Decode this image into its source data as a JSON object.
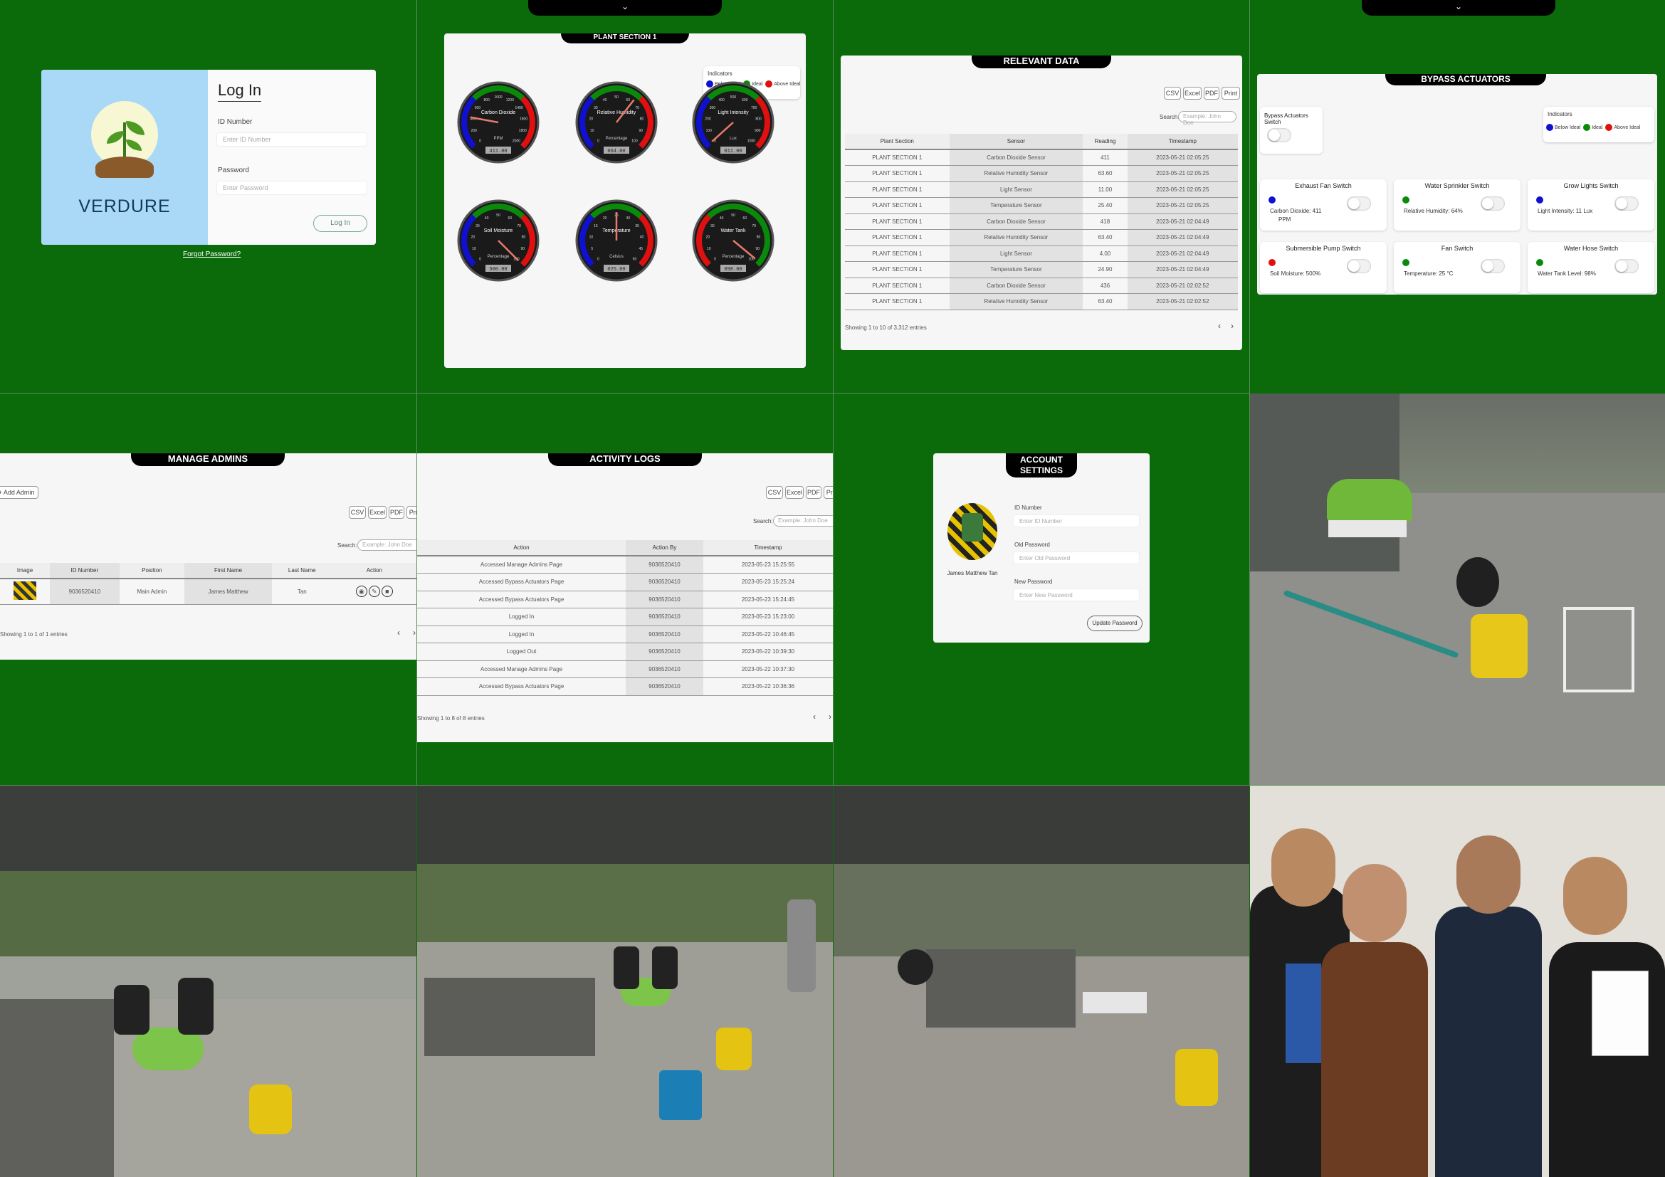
{
  "login": {
    "brand": "VERDURE",
    "heading": "Log In",
    "id_label": "ID Number",
    "id_placeholder": "Enter ID Number",
    "password_label": "Password",
    "password_placeholder": "Enter Password",
    "login_button": "Log In",
    "forgot_link": "Forgot Password?"
  },
  "plant_section": {
    "toggle_glyph": "⌄",
    "title": "PLANT SECTION 1",
    "indicators_title": "Indicators",
    "legend": [
      {
        "label": "Below Ideal",
        "color": "#1010d0"
      },
      {
        "label": "Ideal",
        "color": "#0a8a0a"
      },
      {
        "label": "Above Ideal",
        "color": "#e01010"
      }
    ],
    "gauges": [
      {
        "name": "Carbon Dioxide",
        "unit": "PPM",
        "value": "411.00",
        "reading": 411,
        "max": 2000,
        "ticks": [
          "0",
          "200",
          "400",
          "600",
          "800",
          "1000",
          "1200",
          "1400",
          "1600",
          "1800",
          "2000"
        ]
      },
      {
        "name": "Relative Humidity",
        "unit": "Percentage",
        "value": "064.00",
        "reading": 64,
        "max": 100,
        "ticks": [
          "0",
          "10",
          "20",
          "30",
          "40",
          "50",
          "60",
          "70",
          "80",
          "90",
          "100"
        ]
      },
      {
        "name": "Light Intensity",
        "unit": "Lux",
        "value": "011.00",
        "reading": 11,
        "max": 1000,
        "ticks": [
          "0",
          "100",
          "200",
          "300",
          "400",
          "500",
          "600",
          "700",
          "800",
          "900",
          "1000"
        ]
      },
      {
        "name": "Soil Moisture",
        "unit": "Percentage",
        "value": "500.00",
        "reading": 100,
        "max": 100,
        "ticks": [
          "0",
          "10",
          "20",
          "30",
          "40",
          "50",
          "60",
          "70",
          "80",
          "90",
          "100"
        ]
      },
      {
        "name": "Temperature",
        "unit": "Celsius",
        "value": "025.00",
        "reading": 25,
        "max": 50,
        "ticks": [
          "0",
          "5",
          "10",
          "15",
          "20",
          "25",
          "30",
          "35",
          "40",
          "45",
          "50"
        ]
      },
      {
        "name": "Water Tank",
        "unit": "Percentage",
        "value": "098.00",
        "reading": 98,
        "max": 100,
        "ticks": [
          "0",
          "10",
          "20",
          "30",
          "40",
          "50",
          "60",
          "70",
          "80",
          "90",
          "100"
        ]
      }
    ]
  },
  "relevant_data": {
    "title": "RELEVANT DATA",
    "export_buttons": [
      "CSV",
      "Excel",
      "PDF",
      "Print"
    ],
    "search_label": "Search:",
    "search_placeholder": "Example: John Doe",
    "columns": [
      "Plant Section",
      "Sensor",
      "Reading",
      "Timestamp"
    ],
    "rows": [
      [
        "PLANT SECTION 1",
        "Carbon Dioxide Sensor",
        "411",
        "2023-05-21 02:05:25"
      ],
      [
        "PLANT SECTION 1",
        "Relative Humidity Sensor",
        "63.60",
        "2023-05-21 02:05:25"
      ],
      [
        "PLANT SECTION 1",
        "Light Sensor",
        "11.00",
        "2023-05-21 02:05:25"
      ],
      [
        "PLANT SECTION 1",
        "Temperature Sensor",
        "25.40",
        "2023-05-21 02:05:25"
      ],
      [
        "PLANT SECTION 1",
        "Carbon Dioxide Sensor",
        "418",
        "2023-05-21 02:04:49"
      ],
      [
        "PLANT SECTION 1",
        "Relative Humidity Sensor",
        "63.40",
        "2023-05-21 02:04:49"
      ],
      [
        "PLANT SECTION 1",
        "Light Sensor",
        "4.00",
        "2023-05-21 02:04:49"
      ],
      [
        "PLANT SECTION 1",
        "Temperature Sensor",
        "24.90",
        "2023-05-21 02:04:49"
      ],
      [
        "PLANT SECTION 1",
        "Carbon Dioxide Sensor",
        "436",
        "2023-05-21 02:02:52"
      ],
      [
        "PLANT SECTION 1",
        "Relative Humidity Sensor",
        "63.40",
        "2023-05-21 02:02:52"
      ]
    ],
    "footer": "Showing 1 to 10 of 3,312 entries",
    "prev": "‹",
    "next": "›"
  },
  "bypass": {
    "toggle_glyph": "⌄",
    "title": "BYPASS ACTUATORS",
    "master_label": "Bypass Actuators Switch",
    "indicators_title": "Indicators",
    "legend": [
      {
        "label": "Below Ideal",
        "color": "#1010d0"
      },
      {
        "label": "Ideal",
        "color": "#0a8a0a"
      },
      {
        "label": "Above Ideal",
        "color": "#e01010"
      }
    ],
    "switches": [
      {
        "title": "Exhaust Fan Switch",
        "reading": "Carbon Dioxide: 411",
        "reading2": "PPM",
        "color": "#1010d0"
      },
      {
        "title": "Water Sprinkler Switch",
        "reading": "Relative Humidity: 64%",
        "reading2": "",
        "color": "#0a8a0a"
      },
      {
        "title": "Grow Lights Switch",
        "reading": "Light Intensity: 11 Lux",
        "reading2": "",
        "color": "#1010d0"
      },
      {
        "title": "Submersible Pump Switch",
        "reading": "Soil Moisture: 500%",
        "reading2": "",
        "color": "#e01010"
      },
      {
        "title": "Fan Switch",
        "reading": "Temperature: 25 °C",
        "reading2": "",
        "color": "#0a8a0a"
      },
      {
        "title": "Water Hose Switch",
        "reading": "Water Tank Level: 98%",
        "reading2": "",
        "color": "#0a8a0a"
      }
    ]
  },
  "manage_admins": {
    "title": "MANAGE ADMINS",
    "add_button": "+ Add Admin",
    "export_buttons": [
      "CSV",
      "Excel",
      "PDF",
      "Print"
    ],
    "search_label": "Search:",
    "search_placeholder": "Example: John Doe",
    "columns": [
      "Image",
      "ID Number",
      "Position",
      "First Name",
      "Last Name",
      "Action"
    ],
    "rows": [
      [
        "",
        "9036520410",
        "Main Admin",
        "James Matthew",
        "Tan",
        ""
      ]
    ],
    "footer": "Showing 1 to 1 of 1 entries",
    "prev": "‹",
    "next": "›"
  },
  "activity_logs": {
    "title": "ACTIVITY LOGS",
    "export_buttons": [
      "CSV",
      "Excel",
      "PDF",
      "Print"
    ],
    "search_label": "Search:",
    "search_placeholder": "Example: John Doe",
    "columns": [
      "Action",
      "Action By",
      "Timestamp"
    ],
    "rows": [
      [
        "Accessed Manage Admins Page",
        "9036520410",
        "2023-05-23 15:25:55"
      ],
      [
        "Accessed Bypass Actuators Page",
        "9036520410",
        "2023-05-23 15:25:24"
      ],
      [
        "Accessed Bypass Actuators Page",
        "9036520410",
        "2023-05-23 15:24:45"
      ],
      [
        "Logged In",
        "9036520410",
        "2023-05-23 15:23:00"
      ],
      [
        "Logged In",
        "9036520410",
        "2023-05-22 10:46:45"
      ],
      [
        "Logged Out",
        "9036520410",
        "2023-05-22 10:39:30"
      ],
      [
        "Accessed Manage Admins Page",
        "9036520410",
        "2023-05-22 10:37:30"
      ],
      [
        "Accessed Bypass Actuators Page",
        "9036520410",
        "2023-05-22 10:36:36"
      ]
    ],
    "footer": "Showing 1 to 8 of 8 entries",
    "prev": "‹",
    "next": "›"
  },
  "account": {
    "title_line1": "ACCOUNT",
    "title_line2": "SETTINGS",
    "user_name": "James Matthew Tan",
    "id_label": "ID Number",
    "id_placeholder": "Enter ID Number",
    "old_label": "Old Password",
    "old_placeholder": "Enter Old Password",
    "new_label": "New Password",
    "new_placeholder": "Enter New Password",
    "update_button": "Update Password"
  }
}
